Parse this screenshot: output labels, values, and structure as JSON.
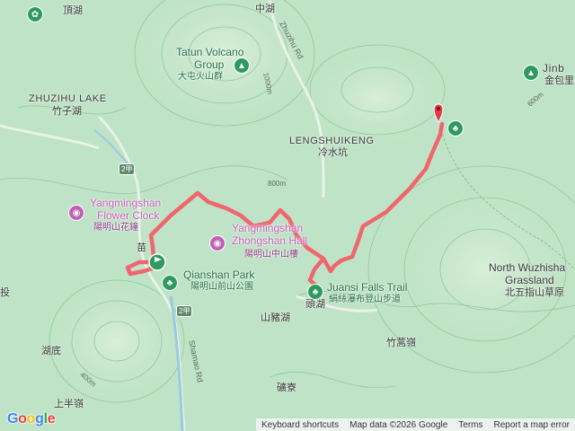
{
  "places": {
    "dinghu": "頂湖",
    "zhonghu": "中湖",
    "zhuzihu_en": "ZHUZIHU LAKE",
    "zhuzihu_zh": "竹子湖",
    "lengshuikeng_en": "LENGSHUIKENG",
    "lengshuikeng_zh": "冷水坑",
    "miao": "苗",
    "tou": "投",
    "hudi": "湖底",
    "shangbanling": "上半嶺",
    "toutouhu": "頭湖",
    "shanzhuhu": "山豬湖",
    "zhugaoling": "竹蒿嶺",
    "weiliao": "礦寮",
    "jin": "Jinb",
    "jinbaoli_zh": "金包里",
    "north_wuzhi_en1": "North Wuzhisha",
    "north_wuzhi_en2": "Grassland",
    "north_wuzhi_zh": "北五指山草原"
  },
  "pois": {
    "tatun_en1": "Tatun Volcano",
    "tatun_en2": "Group",
    "tatun_zh": "大屯火山群",
    "flower_en1": "Yangmingshan",
    "flower_en2": "Flower Clock",
    "flower_zh": "陽明山花鐘",
    "zhongshan_en1": "Yangmingshan",
    "zhongshan_en2": "Zhongshan Hall",
    "zhongshan_zh": "陽明山中山樓",
    "qianshan_en": "Qianshan Park",
    "qianshan_zh": "陽明山前山公園",
    "juansi_en": "Juansi Falls Trail",
    "juansi_zh": "絹絲瀑布登山步道"
  },
  "roads": {
    "zhuzihu_rd": "Zhuzihu Rd",
    "shamao_rd": "Shamao Rd",
    "route2_a": "2甲",
    "route2_b": "2甲",
    "elev_800": "800m",
    "elev_1000": "1000m",
    "elev_600": "600m",
    "elev_400": "400m"
  },
  "icons": {
    "park": "tree-icon",
    "poi": "camera-icon",
    "flag": "start-flag-icon",
    "pin": "end-pin-icon",
    "mountain": "mountain-icon"
  },
  "colors": {
    "route": "#f0656e",
    "terrain": "#bfe3c6",
    "contour": "#8fc49a",
    "water": "#9cc8e6"
  },
  "footer": {
    "keyboard": "Keyboard shortcuts",
    "mapdata": "Map data ©2026 Google",
    "terms": "Terms",
    "report": "Report a map error"
  },
  "logo": "Google"
}
